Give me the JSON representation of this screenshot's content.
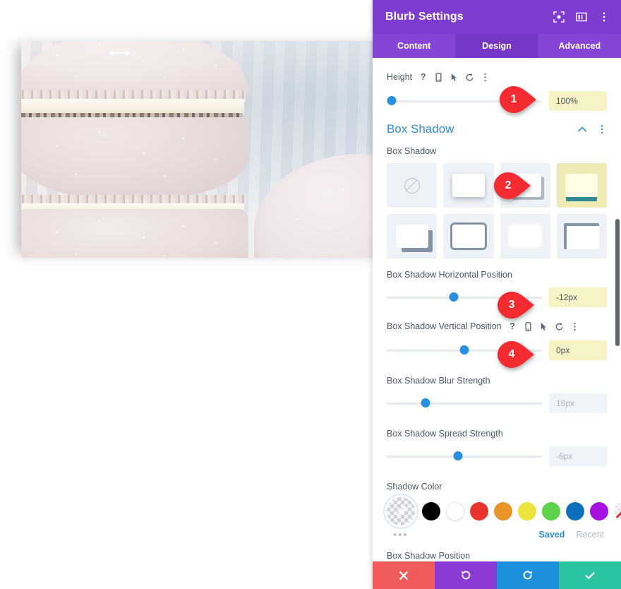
{
  "canvas": {
    "resize_handle_icon": "horizontal-resize-arrow",
    "image_alt": "stacked pink macarons close-up photograph"
  },
  "panel": {
    "title": "Blurb Settings",
    "header_icons": [
      {
        "name": "focus-target-icon"
      },
      {
        "name": "panel-layout-icon"
      },
      {
        "name": "vertical-dots-icon"
      }
    ],
    "tabs": [
      {
        "label": "Content",
        "active": false
      },
      {
        "label": "Design",
        "active": true
      },
      {
        "label": "Advanced",
        "active": false
      }
    ]
  },
  "height_field": {
    "label": "Height",
    "icons": [
      "help-icon",
      "mobile-icon",
      "cursor-icon",
      "reset-icon",
      "vertical-dots-icon"
    ],
    "value": "100%",
    "slider_percent": 3,
    "highlighted": true
  },
  "box_shadow_section": {
    "title": "Box Shadow",
    "collapse_icon": "chevron-up-icon",
    "menu_icon": "vertical-dots-icon",
    "preset_label": "Box Shadow",
    "presets": [
      {
        "name": "preset-none",
        "selected": false
      },
      {
        "name": "preset-soft-drop",
        "selected": false
      },
      {
        "name": "preset-offset-bottom-right",
        "selected": false
      },
      {
        "name": "preset-bottom-bar",
        "selected": true
      },
      {
        "name": "preset-hard-offset",
        "selected": false
      },
      {
        "name": "preset-outline",
        "selected": false
      },
      {
        "name": "preset-blur-glow",
        "selected": false
      },
      {
        "name": "preset-top-left-corner",
        "selected": false
      }
    ]
  },
  "horizontal_position": {
    "label": "Box Shadow Horizontal Position",
    "value": "-12px",
    "slider_percent": 43,
    "highlighted": true
  },
  "vertical_position": {
    "label": "Box Shadow Vertical Position",
    "icons": [
      "help-icon",
      "mobile-icon",
      "cursor-icon",
      "reset-icon",
      "vertical-dots-icon"
    ],
    "value": "0px",
    "slider_percent": 50,
    "highlighted": true
  },
  "blur_strength": {
    "label": "Box Shadow Blur Strength",
    "value": "18px",
    "slider_percent": 25,
    "highlighted": false
  },
  "spread_strength": {
    "label": "Box Shadow Spread Strength",
    "value": "-6px",
    "slider_percent": 46,
    "highlighted": false
  },
  "shadow_color": {
    "label": "Shadow Color",
    "eyedropper_icon": "eyedropper-icon",
    "more_label": "•••",
    "swatches": [
      {
        "name": "swatch-black",
        "color": "#000000"
      },
      {
        "name": "swatch-white",
        "color": "#ffffff"
      },
      {
        "name": "swatch-red",
        "color": "#e8332e"
      },
      {
        "name": "swatch-orange",
        "color": "#e8962a"
      },
      {
        "name": "swatch-yellow",
        "color": "#eae43c"
      },
      {
        "name": "swatch-green",
        "color": "#5ed24a"
      },
      {
        "name": "swatch-blue",
        "color": "#0d6fba"
      },
      {
        "name": "swatch-purple",
        "color": "#a611e0"
      },
      {
        "name": "swatch-transparent",
        "color": "transparent"
      }
    ],
    "saved_label": "Saved",
    "recent_label": "Recent"
  },
  "position_field": {
    "label": "Box Shadow Position"
  },
  "footer": {
    "buttons": [
      {
        "name": "cancel-button",
        "icon": "close-icon",
        "color": "#f15a5a"
      },
      {
        "name": "undo-button",
        "icon": "undo-icon",
        "color": "#8c3ad4"
      },
      {
        "name": "redo-button",
        "icon": "redo-icon",
        "color": "#1e8fdb"
      },
      {
        "name": "save-button",
        "icon": "check-icon",
        "color": "#2bc4a0"
      }
    ]
  },
  "callouts": [
    {
      "number": "1"
    },
    {
      "number": "2"
    },
    {
      "number": "3"
    },
    {
      "number": "4"
    }
  ]
}
